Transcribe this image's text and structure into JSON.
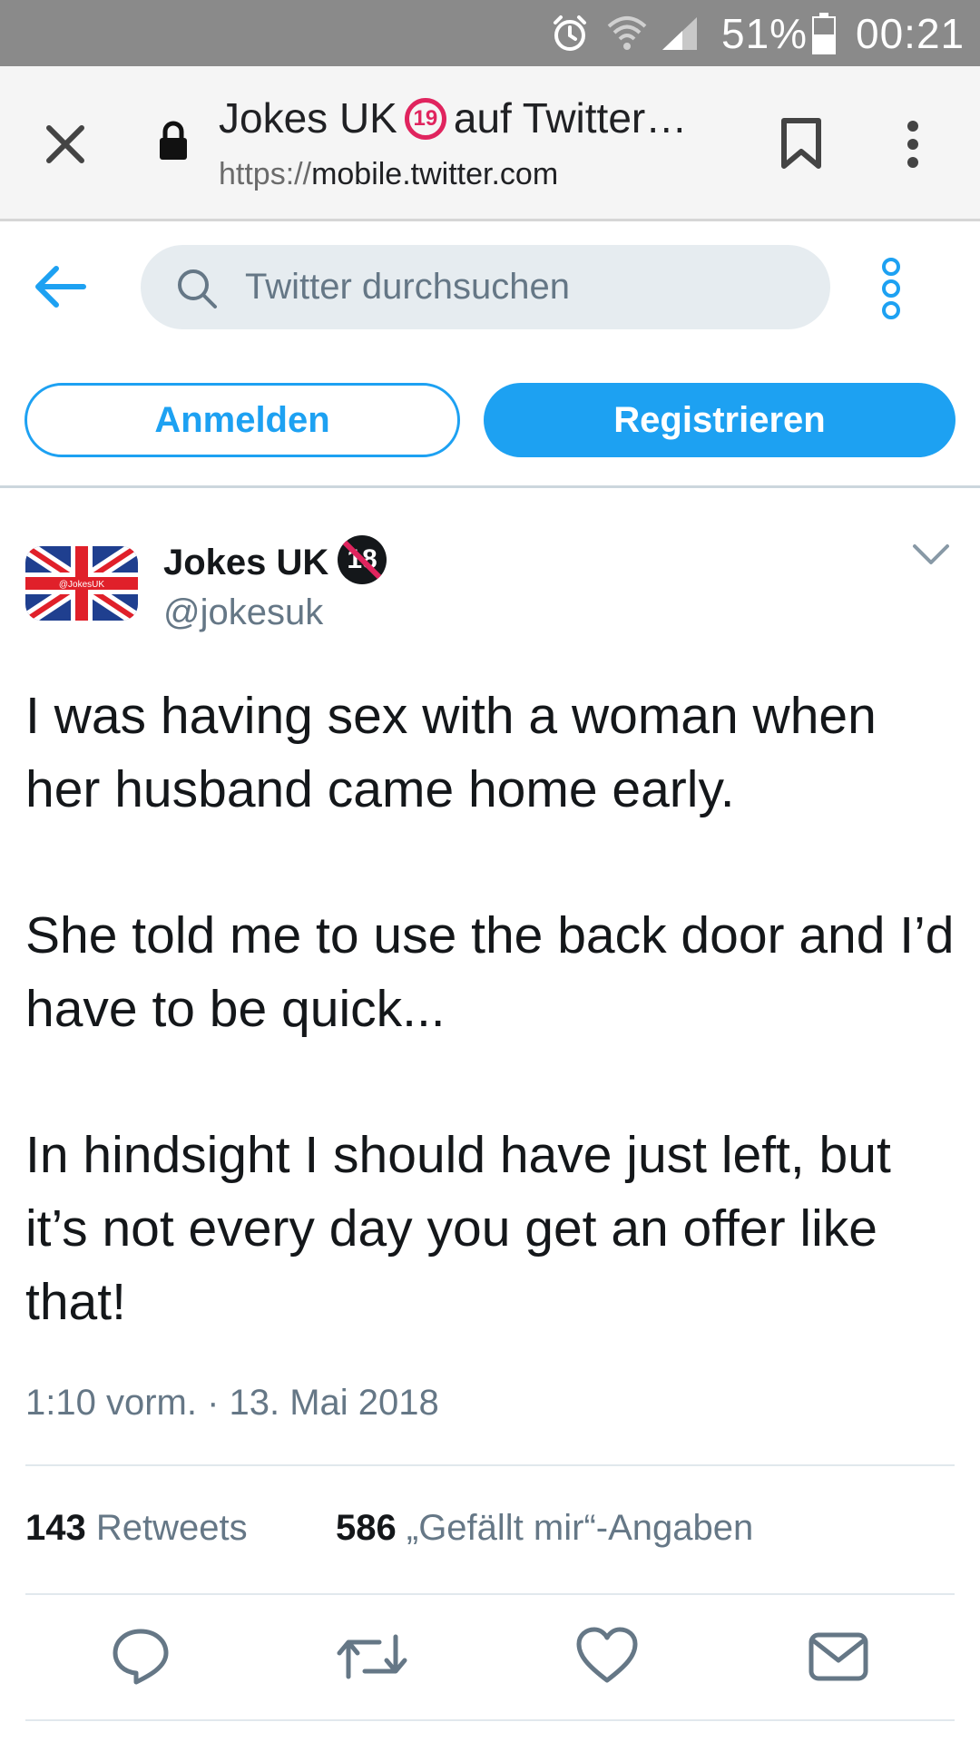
{
  "status_bar": {
    "battery": "51%",
    "time": "00:21"
  },
  "browser": {
    "page_title_prefix": "Jokes UK",
    "age_badge": "19",
    "page_title_suffix": "auf Twitter…",
    "url_protocol": "https://",
    "url_host": "mobile.twitter.com"
  },
  "header": {
    "search_placeholder": "Twitter durchsuchen",
    "login_label": "Anmelden",
    "signup_label": "Registrieren"
  },
  "tweet": {
    "author_name": "Jokes UK",
    "age_badge": "18",
    "handle": "@jokesuk",
    "avatar_text": "@JokesUK",
    "paragraphs": [
      "I was having sex with a woman when her husband came home early.",
      "She told me to use the back door and I’d have to be quick...",
      "In hindsight I should have just left, but it’s not every day you get an offer like that!"
    ],
    "timestamp": "1:10 vorm. · 13. Mai 2018",
    "retweets_count": "143",
    "retweets_label": "Retweets",
    "likes_count": "586",
    "likes_label": "„Gefällt mir“-Angaben"
  },
  "colors": {
    "accent": "#1da1f2",
    "muted_text": "#657786",
    "status_bar": "#8a8a8a"
  },
  "icons": [
    "alarm-icon",
    "wifi-icon",
    "signal-icon",
    "battery-icon",
    "close-icon",
    "lock-icon",
    "bookmark-icon",
    "overflow-menu-icon",
    "back-arrow-icon",
    "search-icon",
    "more-icon",
    "chevron-down-icon",
    "reply-icon",
    "retweet-icon",
    "like-icon",
    "share-icon"
  ]
}
